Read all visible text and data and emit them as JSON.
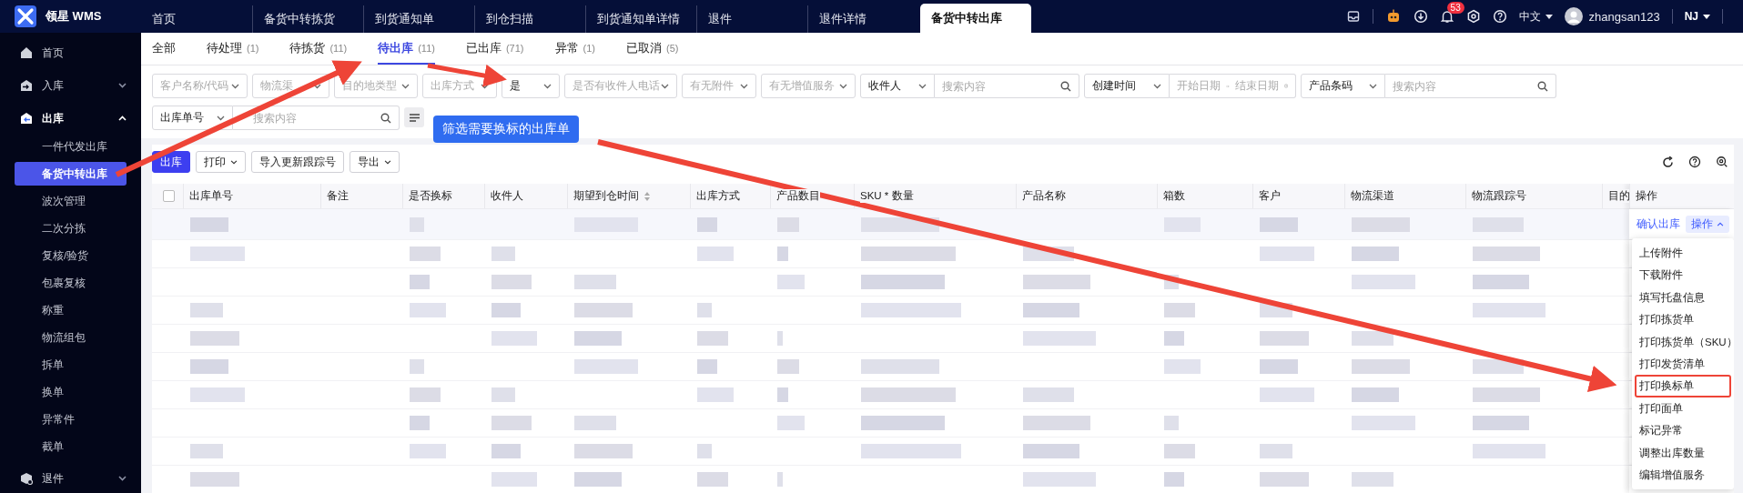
{
  "app": {
    "logo_text": "领星 WMS"
  },
  "nav_tabs": [
    {
      "label": "首页",
      "selected": false
    },
    {
      "label": "备货中转拣货",
      "selected": false
    },
    {
      "label": "到货通知单",
      "selected": false
    },
    {
      "label": "到仓扫描",
      "selected": false
    },
    {
      "label": "到货通知单详情",
      "selected": false
    },
    {
      "label": "退件",
      "selected": false
    },
    {
      "label": "退件详情",
      "selected": false
    },
    {
      "label": "备货中转出库",
      "selected": true
    }
  ],
  "header_right": {
    "notification_count": "53",
    "language": "中文",
    "username": "zhangsan123",
    "warehouse": "NJ"
  },
  "sidebar": {
    "items": [
      {
        "label": "首页"
      },
      {
        "label": "入库",
        "expanded": false
      },
      {
        "label": "出库",
        "expanded": true,
        "children": [
          {
            "label": "一件代发出库",
            "selected": false
          },
          {
            "label": "备货中转出库",
            "selected": true
          },
          {
            "label": "波次管理",
            "selected": false
          },
          {
            "label": "二次分拣",
            "selected": false
          },
          {
            "label": "复核/验货",
            "selected": false
          },
          {
            "label": "包裹复核",
            "selected": false
          },
          {
            "label": "称重",
            "selected": false
          },
          {
            "label": "物流组包",
            "selected": false
          },
          {
            "label": "拆单",
            "selected": false
          },
          {
            "label": "换单",
            "selected": false
          },
          {
            "label": "异常件",
            "selected": false
          },
          {
            "label": "截单",
            "selected": false
          }
        ]
      },
      {
        "label": "退件",
        "expanded": false
      }
    ]
  },
  "status_tabs": [
    {
      "label": "全部",
      "selected": false
    },
    {
      "label": "待处理",
      "count": "(1)",
      "selected": false
    },
    {
      "label": "待拣货",
      "count": "(11)",
      "selected": false
    },
    {
      "label": "待出库",
      "count": "(11)",
      "selected": true
    },
    {
      "label": "已出库",
      "count": "(71)",
      "selected": false
    },
    {
      "label": "异常",
      "count": "(1)",
      "selected": false
    },
    {
      "label": "已取消",
      "count": "(5)",
      "selected": false
    }
  ],
  "filters": {
    "row_1": [
      {
        "kind": "select",
        "placeholder": "客户名称/代码"
      },
      {
        "kind": "select",
        "placeholder": "物流渠"
      },
      {
        "kind": "select",
        "placeholder": "目的地类型"
      },
      {
        "kind": "select",
        "placeholder": "出库方式"
      },
      {
        "kind": "select",
        "value": "是"
      },
      {
        "kind": "select",
        "placeholder": "是否有收件人电话"
      },
      {
        "kind": "select",
        "placeholder": "有无附件"
      },
      {
        "kind": "select",
        "placeholder": "有无增值服务"
      },
      {
        "kind": "select_search",
        "select": "收件人",
        "placeholder": "搜索内容"
      },
      {
        "kind": "date_range",
        "select": "创建时间",
        "start_placeholder": "开始日期",
        "end_placeholder": "结束日期"
      },
      {
        "kind": "select_search",
        "select": "产品条码",
        "placeholder": "搜索内容"
      }
    ],
    "row_2": [
      {
        "kind": "select_search",
        "select": "出库单号",
        "placeholder": "搜索内容"
      },
      {
        "kind": "filter_button"
      }
    ]
  },
  "callout": "筛选需要换标的出库单",
  "toolbar": [
    {
      "label": "出库",
      "kind": "primary"
    },
    {
      "label": "打印",
      "kind": "dropdown"
    },
    {
      "label": "导入更新跟踪号",
      "kind": "plain"
    },
    {
      "label": "导出",
      "kind": "dropdown"
    }
  ],
  "table": {
    "select_all_checked": false,
    "columns": [
      {
        "label": "出库单号"
      },
      {
        "label": "备注"
      },
      {
        "label": "是否换标"
      },
      {
        "label": "收件人"
      },
      {
        "label": "期望到仓时间",
        "sortable": true
      },
      {
        "label": "出库方式"
      },
      {
        "label": "产品数目"
      },
      {
        "label": "SKU * 数量"
      },
      {
        "label": "产品名称"
      },
      {
        "label": "箱数"
      },
      {
        "label": "客户"
      },
      {
        "label": "物流渠道"
      },
      {
        "label": "物流跟踪号"
      },
      {
        "label": "目的"
      },
      {
        "label": "操作"
      }
    ],
    "row_actions": {
      "link": "确认出库",
      "menu_button": "操作",
      "menu_expanded": true
    },
    "menu_items": [
      {
        "label": "上传附件",
        "highlighted": false
      },
      {
        "label": "下载附件",
        "highlighted": false
      },
      {
        "label": "填写托盘信息",
        "highlighted": false
      },
      {
        "label": "打印拣货单",
        "highlighted": false
      },
      {
        "label": "打印拣货单（SKU）",
        "highlighted": false
      },
      {
        "label": "打印发货清单",
        "highlighted": false
      },
      {
        "label": "打印换标单",
        "highlighted": true
      },
      {
        "label": "打印面单",
        "highlighted": false
      },
      {
        "label": "标记异常",
        "highlighted": false
      },
      {
        "label": "调整出库数量",
        "highlighted": false
      },
      {
        "label": "编辑增值服务",
        "highlighted": false
      }
    ]
  }
}
